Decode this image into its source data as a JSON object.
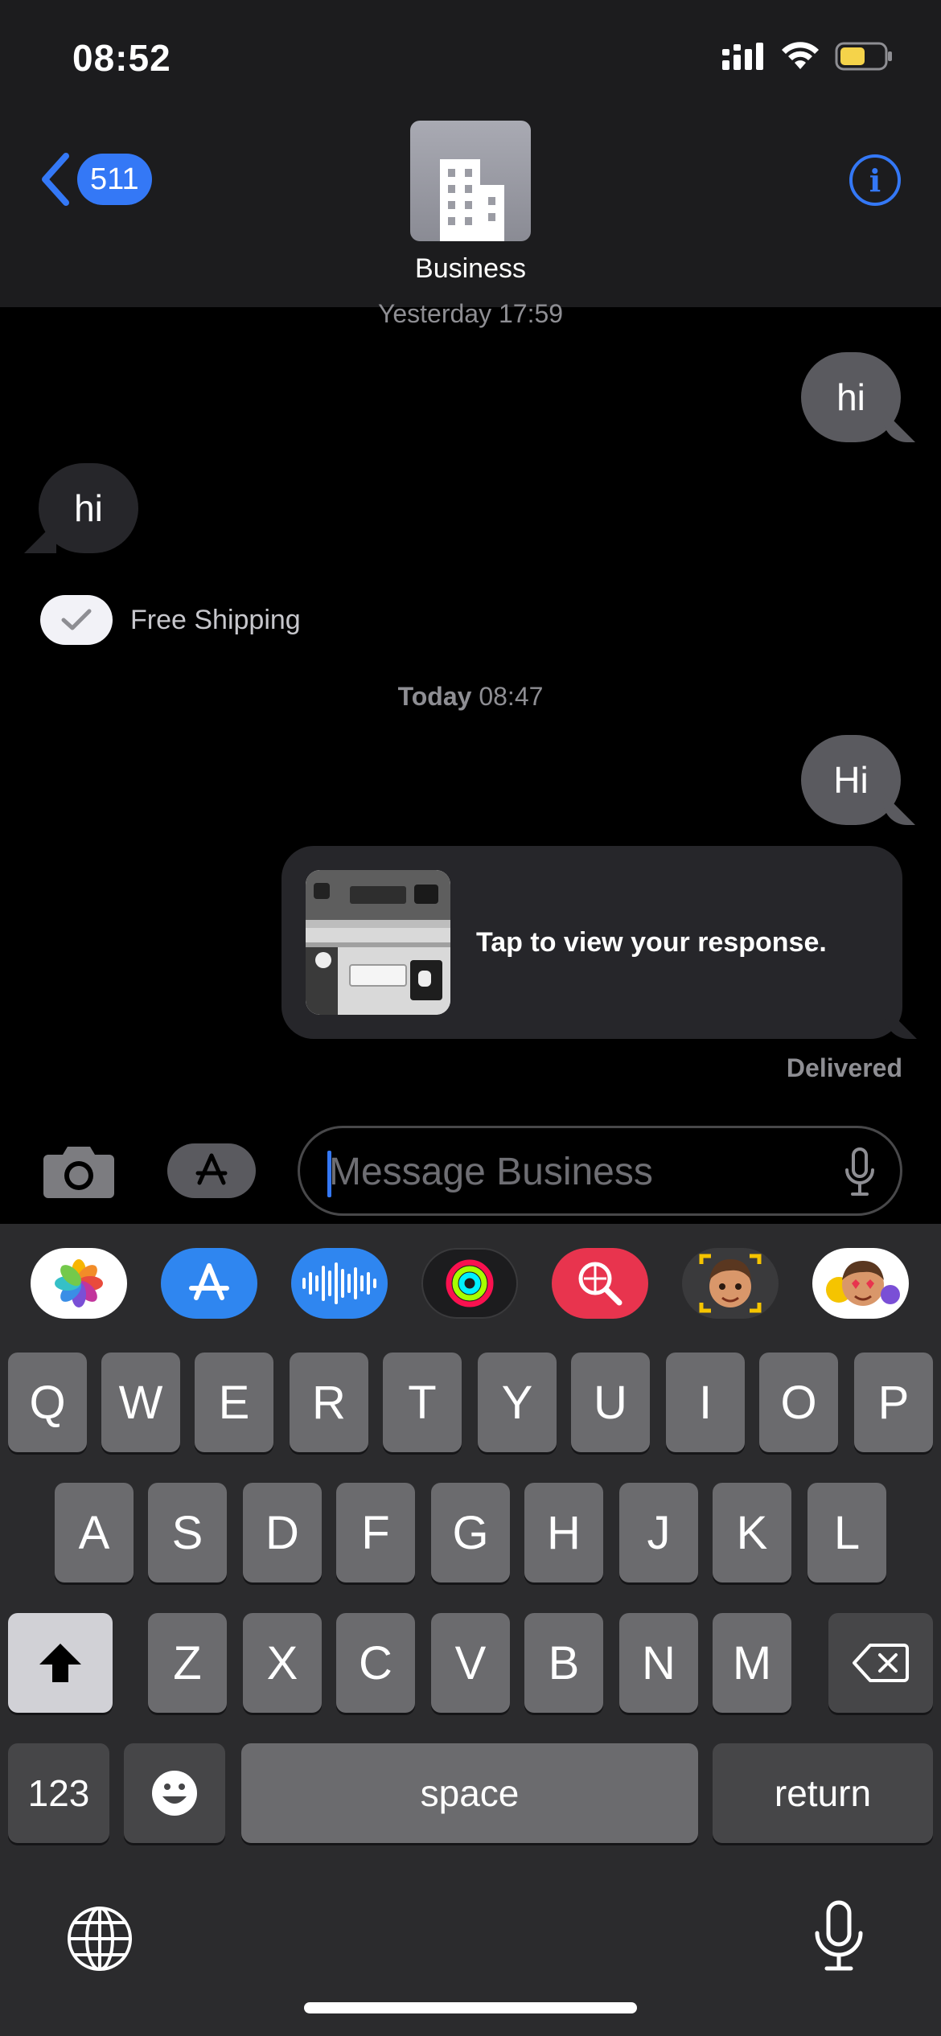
{
  "status_bar": {
    "time": "08:52"
  },
  "header": {
    "back_badge": "511",
    "contact_name": "Business",
    "info_label": "i"
  },
  "thread": {
    "stamp_1": "Yesterday 17:59",
    "msg_out_1": "hi",
    "msg_in_1": "hi",
    "check_label": "Free Shipping",
    "stamp_2_day": "Today",
    "stamp_2_time": " 08:47",
    "msg_out_2": "Hi",
    "rich_link_text": "Tap to view your response.",
    "delivered": "Delivered"
  },
  "composer": {
    "placeholder": "Message Business"
  },
  "app_strip": [
    "photos-icon",
    "app-store-icon",
    "audio-icon",
    "activity-icon",
    "search-images-icon",
    "memoji-icon",
    "memoji-stickers-icon"
  ],
  "keyboard": {
    "row1": [
      "Q",
      "W",
      "E",
      "R",
      "T",
      "Y",
      "U",
      "I",
      "O",
      "P"
    ],
    "row2": [
      "A",
      "S",
      "D",
      "F",
      "G",
      "H",
      "J",
      "K",
      "L"
    ],
    "row3": [
      "Z",
      "X",
      "C",
      "V",
      "B",
      "N",
      "M"
    ],
    "numbers": "123",
    "space": "space",
    "return": "return"
  },
  "colors": {
    "accent": "#3478f6",
    "bubble_out": "#5a5a5f",
    "bubble_in": "#26262a",
    "keyboard_bg": "#2b2b2d",
    "key": "#6b6b6e"
  }
}
